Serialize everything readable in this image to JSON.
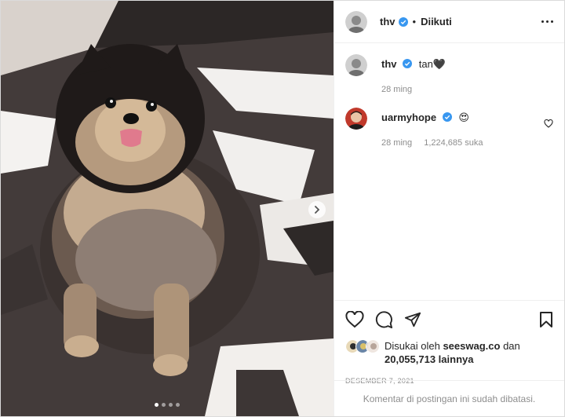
{
  "post": {
    "author": "thv",
    "follow_status": "Diikuti",
    "separator": "•",
    "more_icon": "more-horizontal-icon",
    "photo_icon": "dog-photo",
    "carousel": {
      "total": 4,
      "active": 0
    }
  },
  "comments": [
    {
      "user": "thv",
      "text": "tan🖤",
      "time": "28 ming",
      "likes": ""
    },
    {
      "user": "uarmyhope",
      "text": "😍",
      "time": "28 ming",
      "likes": "1,224,685 suka"
    }
  ],
  "actions": {
    "icons": [
      "heart-icon",
      "comment-icon",
      "share-icon",
      "bookmark-icon"
    ]
  },
  "likes_line": {
    "prefix": "Disukai oleh",
    "user": "seeswag.co",
    "conj": "dan",
    "count": "20,055,713 lainnya"
  },
  "date": "DESEMBER 7, 2021",
  "footer_text": "Komentar di postingan ini sudah dibatasi.",
  "colors": {
    "verified": "#3897f0",
    "muted": "#8e8e8e",
    "text": "#262626"
  }
}
